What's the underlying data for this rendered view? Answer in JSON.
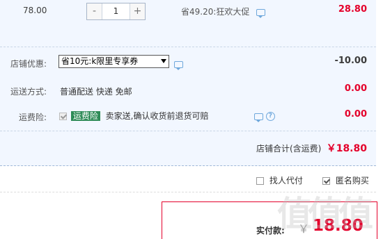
{
  "item": {
    "unit_price": "78.00",
    "stepper": {
      "minus": "-",
      "quantity": "1",
      "plus": "+"
    },
    "promo_text": "省49.20:狂欢大促",
    "total": "28.80"
  },
  "shop_discount": {
    "label": "店铺优惠:",
    "selected": "省10元:k限里专享券",
    "value": "-10.00"
  },
  "shipping": {
    "label": "运送方式:",
    "method": "普通配送 快递 免邮",
    "value": "0.00"
  },
  "insurance": {
    "label": "运费险:",
    "tag": "运费险",
    "description": "卖家送,确认收货前退货可赔",
    "value": "0.00"
  },
  "shop_total": {
    "label": "店铺合计(含运费)",
    "value": "￥18.80"
  },
  "options": {
    "pay_for_me": "找人代付",
    "anonymous": "匿名购买"
  },
  "payment": {
    "label": "实付款:",
    "currency": "￥",
    "amount": "18.80"
  },
  "watermark": "值值值",
  "colors": {
    "accent_red": "#e4002b",
    "panel_bg": "#f2f7ff",
    "tag_green": "#2e8b57",
    "icon_blue": "#6fa8dc"
  },
  "icons": [
    "chat-icon",
    "help-icon",
    "dropdown-arrow-icon",
    "checkbox-icon"
  ]
}
